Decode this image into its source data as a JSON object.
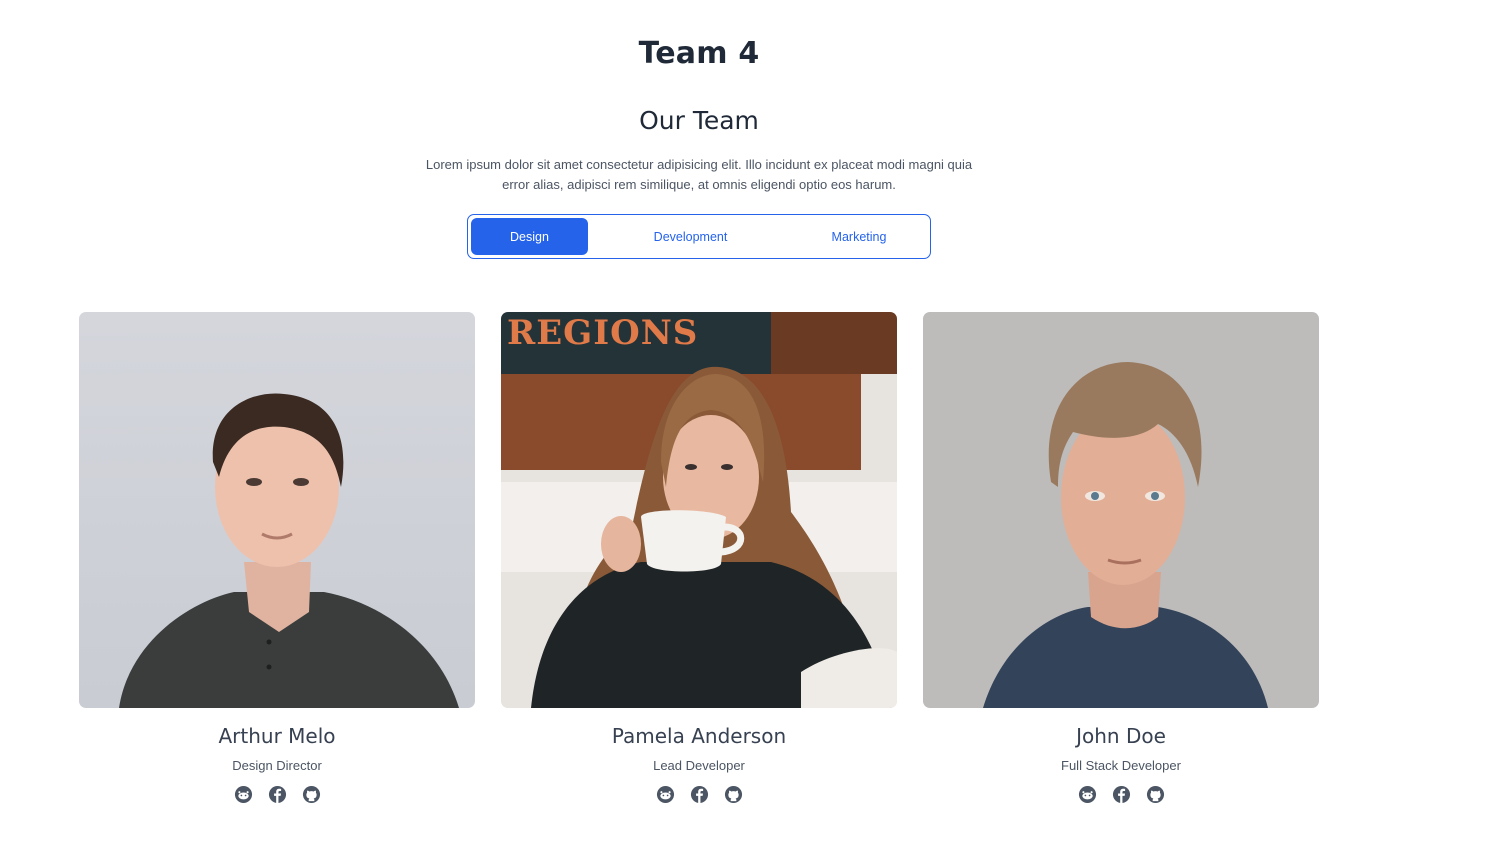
{
  "page": {
    "heading": "Team 4"
  },
  "section": {
    "title": "Our Team",
    "description": "Lorem ipsum dolor sit amet consectetur adipisicing elit. Illo incidunt ex placeat modi magni quia error alias, adipisci rem similique, at omnis eligendi optio eos harum."
  },
  "tabs": [
    {
      "label": "Design",
      "active": true
    },
    {
      "label": "Development",
      "active": false
    },
    {
      "label": "Marketing",
      "active": false
    }
  ],
  "members": [
    {
      "name": "Arthur Melo",
      "role": "Design Director",
      "socials": [
        "reddit-icon",
        "facebook-icon",
        "github-icon"
      ]
    },
    {
      "name": "Pamela Anderson",
      "role": "Lead Developer",
      "socials": [
        "reddit-icon",
        "facebook-icon",
        "github-icon"
      ]
    },
    {
      "name": "John Doe",
      "role": "Full Stack Developer",
      "socials": [
        "reddit-icon",
        "facebook-icon",
        "github-icon"
      ]
    }
  ],
  "photo_signage": "REGIONS",
  "colors": {
    "accent": "#2563eb",
    "heading": "#1f2937",
    "body_text": "#4b5563",
    "icon": "#4b5563"
  }
}
